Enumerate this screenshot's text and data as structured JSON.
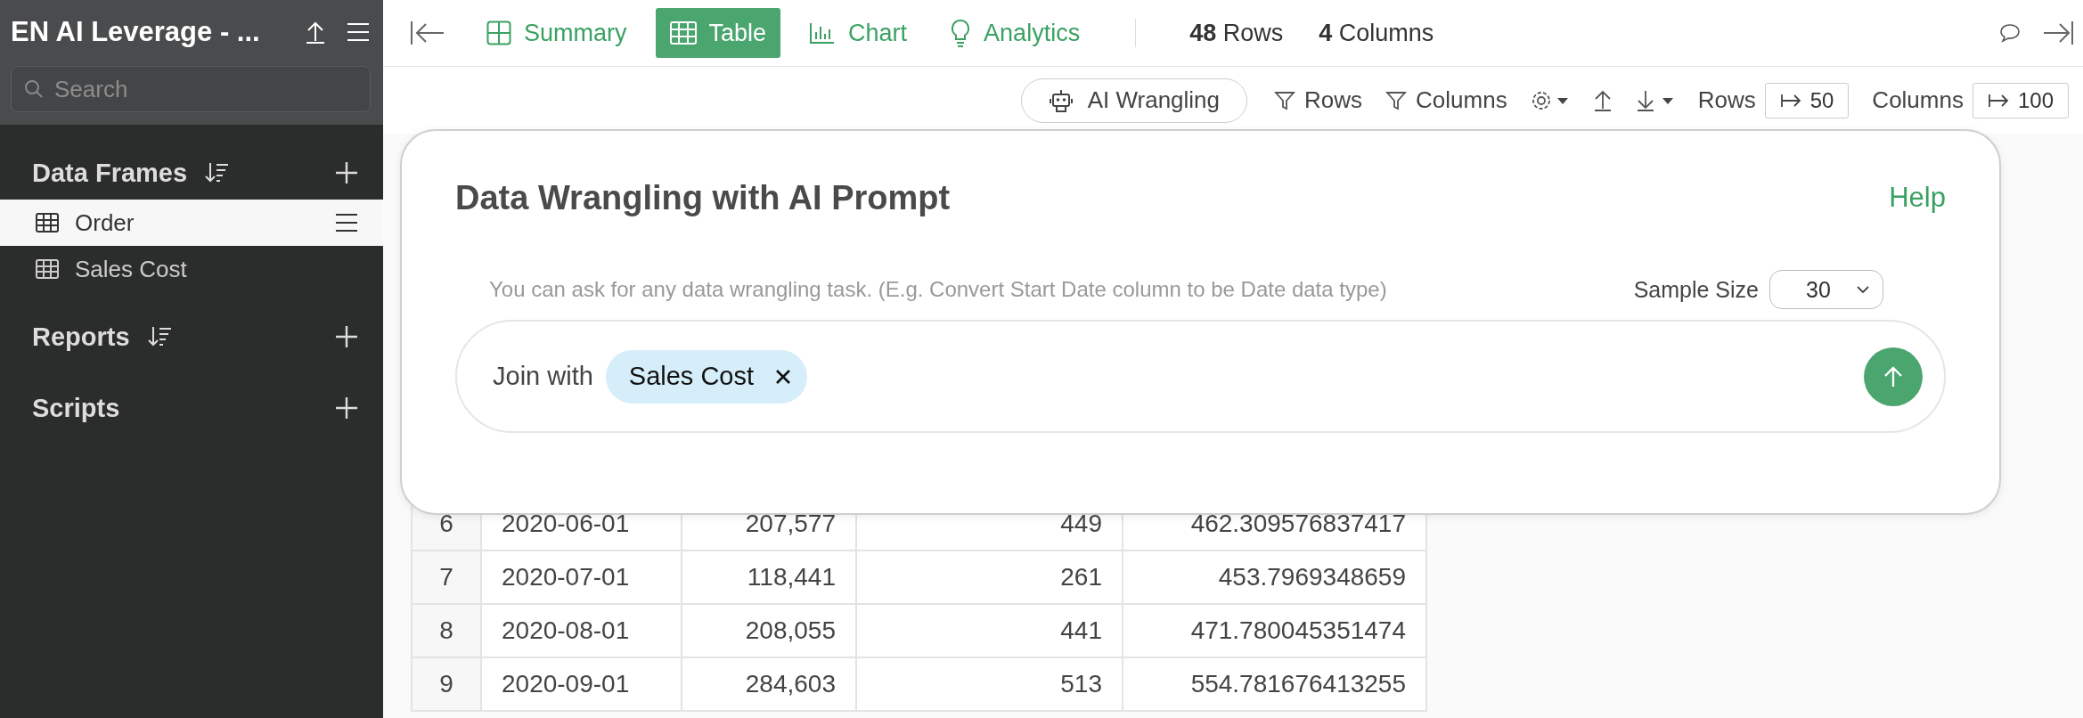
{
  "sidebar": {
    "title": "EN AI Leverage - ...",
    "search": {
      "placeholder": "Search"
    },
    "sections": [
      {
        "label": "Data Frames",
        "sortable": true,
        "items": [
          {
            "label": "Order",
            "selected": true
          },
          {
            "label": "Sales Cost",
            "selected": false
          }
        ]
      },
      {
        "label": "Reports",
        "sortable": true
      },
      {
        "label": "Scripts",
        "sortable": false
      }
    ]
  },
  "topbar": {
    "views": [
      {
        "label": "Summary",
        "kind": "summary",
        "selected": false
      },
      {
        "label": "Table",
        "kind": "table",
        "selected": true
      },
      {
        "label": "Chart",
        "kind": "chart",
        "selected": false
      },
      {
        "label": "Analytics",
        "kind": "analytics",
        "selected": false
      }
    ],
    "stats": [
      "**48** Rows",
      "**4** Columns"
    ]
  },
  "toolbar": {
    "ai_button": "AI Wrangling",
    "rows_filter": "Rows",
    "columns_filter": "Columns",
    "rows_limit": {
      "label": "Rows",
      "value": "50"
    },
    "columns_limit": {
      "label": "Columns",
      "value": "100"
    }
  },
  "modal": {
    "title": "Data Wrangling with AI Prompt",
    "help": "Help",
    "hint": "You can ask for any data wrangling task. (E.g. Convert Start Date column to be Date data type)",
    "sample_size": {
      "label": "Sample Size",
      "value": "30"
    },
    "prompt": {
      "prefix": "Join with",
      "chip": "Sales Cost"
    }
  },
  "table": {
    "rows": [
      {
        "index": "6",
        "cells": [
          "2020-06-01",
          "207,577",
          "449",
          "462.309576837417"
        ]
      },
      {
        "index": "7",
        "cells": [
          "2020-07-01",
          "118,441",
          "261",
          "453.7969348659"
        ]
      },
      {
        "index": "8",
        "cells": [
          "2020-08-01",
          "208,055",
          "441",
          "471.780045351474"
        ]
      },
      {
        "index": "9",
        "cells": [
          "2020-09-01",
          "284,603",
          "513",
          "554.781676413255"
        ]
      }
    ]
  }
}
